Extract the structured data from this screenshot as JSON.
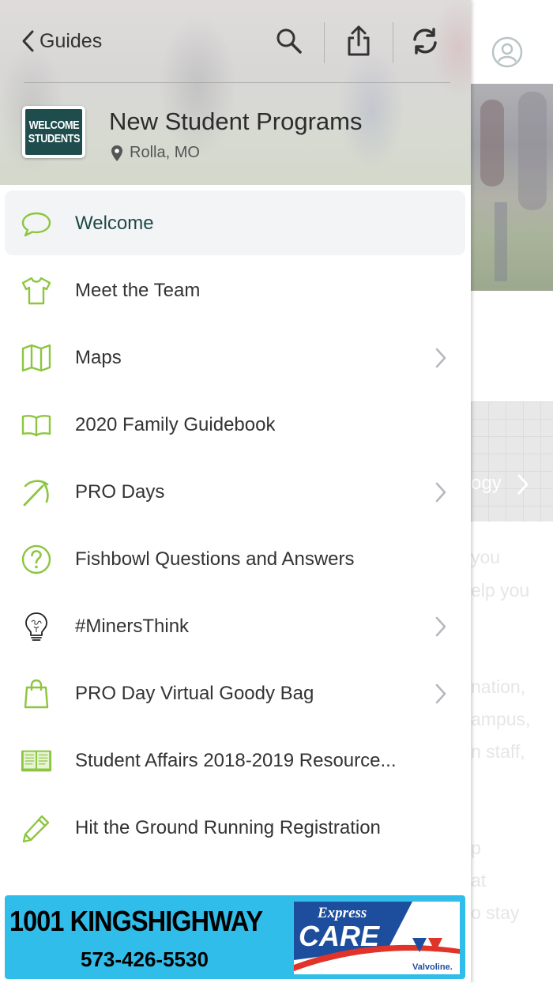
{
  "navigation": {
    "back_label": "Guides"
  },
  "header": {
    "org_title": "New Student Programs",
    "location": "Rolla, MO",
    "logo_line1": "WELCOME",
    "logo_line2": "STUDENTS"
  },
  "toolbar": {
    "icons": [
      "search-icon",
      "share-icon",
      "refresh-icon"
    ]
  },
  "menu": {
    "items": [
      {
        "label": "Welcome",
        "icon": "speech-bubble-icon",
        "active": true,
        "chevron": false
      },
      {
        "label": "Meet the Team",
        "icon": "tshirt-icon",
        "chevron": false
      },
      {
        "label": "Maps",
        "icon": "map-icon",
        "chevron": true
      },
      {
        "label": "2020 Family Guidebook",
        "icon": "open-book-icon",
        "chevron": false
      },
      {
        "label": "PRO Days",
        "icon": "pickaxe-icon",
        "chevron": true
      },
      {
        "label": "Fishbowl Questions and Answers",
        "icon": "question-circle-icon",
        "chevron": false
      },
      {
        "label": "#MinersThink",
        "icon": "lightbulb-icon",
        "chevron": true
      },
      {
        "label": "PRO Day Virtual Goody Bag",
        "icon": "shopping-bag-icon",
        "chevron": true
      },
      {
        "label": "Student Affairs 2018-2019 Resource...",
        "icon": "book-icon",
        "chevron": false
      },
      {
        "label": "Hit the Ground Running Registration",
        "icon": "pencil-icon",
        "chevron": false
      }
    ]
  },
  "ad": {
    "address": "1001 KINGSHIGHWAY",
    "phone": "573-426-5530",
    "brand_top": "Express",
    "brand_main": "CARE",
    "brand_bottom": "Valvoline."
  },
  "background_page": {
    "card_label": "ogy",
    "text_fragments": [
      "you",
      "elp you",
      "nation,",
      "ampus,",
      "n staff,",
      "p",
      "at",
      "o stay"
    ]
  },
  "colors": {
    "accent_green": "#8cc63f",
    "active_text": "#1e4848",
    "ad_blue": "#31bde9"
  }
}
